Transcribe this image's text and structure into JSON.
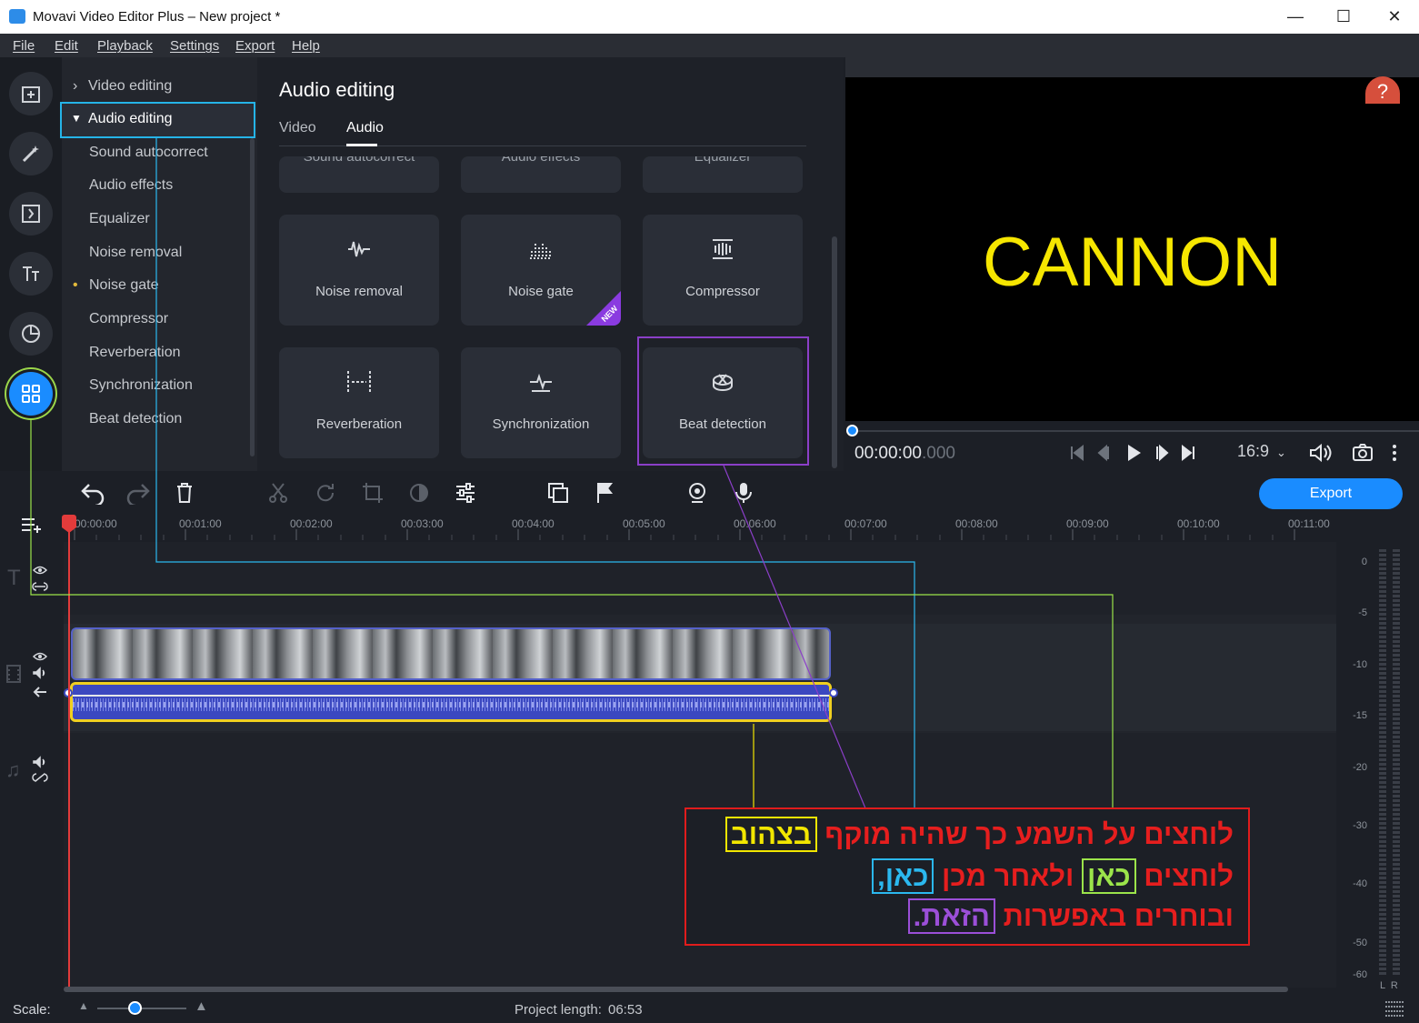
{
  "window": {
    "title": "Movavi Video Editor Plus – New project *",
    "minimize": "—",
    "maximize": "☐",
    "close": "✕"
  },
  "menu": [
    "File",
    "Edit",
    "Playback",
    "Settings",
    "Export",
    "Help"
  ],
  "categories": {
    "video_editing": "Video editing",
    "audio_editing": "Audio editing",
    "items": [
      "Sound autocorrect",
      "Audio effects",
      "Equalizer",
      "Noise removal",
      "Noise gate",
      "Compressor",
      "Reverberation",
      "Synchronization",
      "Beat detection"
    ]
  },
  "panel": {
    "title": "Audio editing",
    "tabs": [
      "Video",
      "Audio"
    ],
    "active_tab": "Audio",
    "partial_tiles": [
      "Sound autocorrect",
      "Audio effects",
      "Equalizer"
    ],
    "tiles": [
      {
        "label": "Noise removal",
        "icon": "noise-removal-icon"
      },
      {
        "label": "Noise gate",
        "icon": "noise-gate-icon",
        "badge": "NEW"
      },
      {
        "label": "Compressor",
        "icon": "compressor-icon"
      },
      {
        "label": "Reverberation",
        "icon": "reverberation-icon"
      },
      {
        "label": "Synchronization",
        "icon": "synchronization-icon"
      },
      {
        "label": "Beat detection",
        "icon": "beat-detection-icon"
      }
    ]
  },
  "preview": {
    "text": "CANNON",
    "help": "?",
    "timecode_main": "00:00:00",
    "timecode_ms": ".000",
    "aspect": "16:9"
  },
  "toolbar": {
    "export_label": "Export"
  },
  "ruler": {
    "labels": [
      "00:00:00",
      "00:01:00",
      "00:02:00",
      "00:03:00",
      "00:04:00",
      "00:05:00",
      "00:06:00",
      "00:07:00",
      "00:08:00",
      "00:09:00",
      "00:10:00",
      "00:11:00"
    ]
  },
  "vu_meter": {
    "labels": [
      "0",
      "-5",
      "-10",
      "-15",
      "-20",
      "-30",
      "-40",
      "-50",
      "-60"
    ],
    "channels": "L  R"
  },
  "status": {
    "scale_label": "Scale:",
    "project_length_label": "Project length:",
    "project_length_value": "06:53"
  },
  "annotation": {
    "line1_text": "לוחצים על השמע כך שהיה מוקף ",
    "line1_highlight": "בצהוב",
    "line2_text_a": "לוחצים ",
    "line2_highlight_a": "כאן",
    "line2_text_b": " ולאחר מכן ",
    "line2_highlight_b": "כאן,",
    "line3_text": "ובוחרים באפשרות ",
    "line3_highlight": "הזאת."
  },
  "colors": {
    "accent": "#1a8cff",
    "annotation_red": "#e61e1e",
    "highlight_yellow": "#f2e600",
    "highlight_green": "#9be44a",
    "highlight_cyan": "#2bb8ef",
    "highlight_purple": "#9b4fd8"
  }
}
